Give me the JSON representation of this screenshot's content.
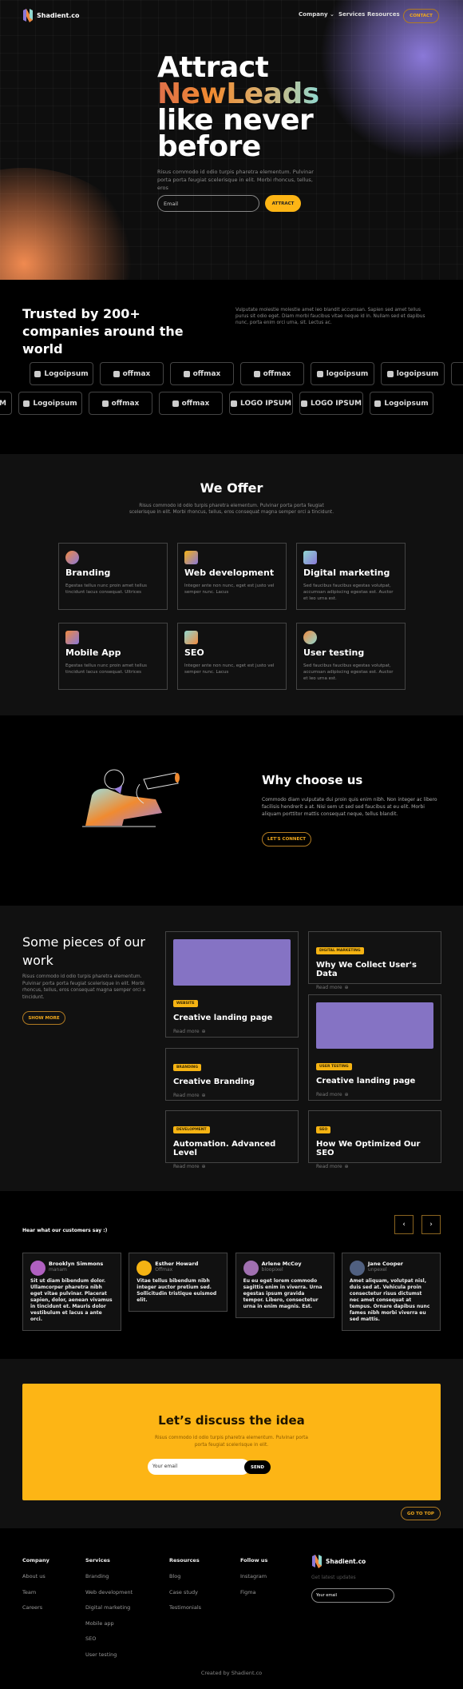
{
  "brand": {
    "name": "Shadient.co"
  },
  "nav": {
    "items": [
      "Company",
      "Services",
      "Resources"
    ],
    "contact": "CONTACT"
  },
  "hero": {
    "line1": "Attract",
    "line2": "NewLeads",
    "line3": "like never",
    "line4": "before",
    "text": "Risus commodo id odio turpis pharetra elementum. Pulvinar porta porta feugiat scelerisque in elit. Morbi rhoncus, tellus, eros",
    "email_placeholder": "Email",
    "cta": "ATTRACT"
  },
  "trusted": {
    "title": "Trusted by 200+ companies around the world",
    "text": "Vulputate molestie molestie amet leo blandit accumsan. Sapien sed amet tellus purus sit odio eget. Diam morbi faucibus vitae neque id in. Nullam sed et dapibus nunc, porta enim orci urna, sit. Lectus ac.",
    "row1": [
      "Logoipsum",
      "offmax",
      "offmax",
      "offmax",
      "logoipsum",
      "logoipsum"
    ],
    "row2": [
      "M",
      "Logoipsum",
      "offmax",
      "offmax",
      "LOGO IPSUM",
      "LOGO IPSUM",
      "Logoipsum"
    ]
  },
  "offer": {
    "title": "We Offer",
    "text": "Risus commodo id odio turpis pharetra elementum. Pulvinar porta porta feugiat scelerisque in elit. Morbi rhoncus, tellus, eros consequat magna semper orci a tincidunt.",
    "items": [
      {
        "title": "Branding",
        "text": "Egestas tellus nunc proin amet tellus tincidunt lacus consequat. Ultrices",
        "icon": "branding-icon"
      },
      {
        "title": "Web development",
        "text": "Integer ante non nunc, eget est justo vel semper nunc. Lacus",
        "icon": "web-icon"
      },
      {
        "title": "Digital marketing",
        "text": "Sed faucibus faucibus egestas volutpat, accumsan adipiscing egestas est. Auctor et leo urna est.",
        "icon": "marketing-icon"
      },
      {
        "title": "Mobile App",
        "text": "Egestas tellus nunc proin amet tellus tincidunt lacus consequat. Ultrices",
        "icon": "mobile-icon"
      },
      {
        "title": "SEO",
        "text": "Integer ante non nunc, eget est justo vel semper nunc. Lacus",
        "icon": "seo-icon"
      },
      {
        "title": "User testing",
        "text": "Sed faucibus faucibus egestas volutpat, accumsan adipiscing egestas est. Auctor et leo urna est.",
        "icon": "user-icon"
      }
    ]
  },
  "why": {
    "title": "Why choose us",
    "text": "Commodo diam vulputate dui proin quis enim nibh. Non integer ac libero facilisis hendrerit a at. Nisi sem ut sed sed faucibus at eu elit. Morbi aliquam porttitor mattis consequat neque, tellus blandit.",
    "cta": "LET'S CONNECT"
  },
  "work": {
    "title": "Some pieces of our work",
    "text": "Risus commodo id odio turpis pharetra elementum. Pulvinar porta porta feugiat scelerisque in elit. Morbi rhoncus, tellus, eros consequat magna semper orci a tincidunt.",
    "cta": "SHOW MORE",
    "read_more": "Read more",
    "items": [
      {
        "tag": "WEBSITE",
        "title": "Creative landing page"
      },
      {
        "tag": "DIGITAL MARKETING",
        "title": "Why We Collect User's Data"
      },
      {
        "tag": "USER TESTING",
        "title": "Creative landing page"
      },
      {
        "tag": "BRANDING",
        "title": "Creative Branding"
      },
      {
        "tag": "DEVELOPMENT",
        "title": "Automation. Advanced Level"
      },
      {
        "tag": "SEO",
        "title": "How We Optimized Our SEO"
      }
    ],
    "image_color": "#8573c4"
  },
  "testimonials": {
    "title": "Hear what our customers say :)",
    "prev": "‹",
    "next": "›",
    "items": [
      {
        "name": "Brooklyn Simmons",
        "company": "manam",
        "text": "Sit ut diam bibendum dolor. Ullamcorper pharetra nibh eget vitae pulvinar. Placerat sapien, dolor, aenean vivamus in tincidunt et. Mauris dolor vestibulum et lacus a ante orci."
      },
      {
        "name": "Esther Howard",
        "company": "Offmax",
        "text": "Vitae tellus bibendum nibh integer auctor pretium sed. Sollicitudin tristique euismod elit."
      },
      {
        "name": "Arlene McCoy",
        "company": "bloopixel",
        "text": "Eu eu eget lorem commodo sagittis enim in viverra. Urna egestas ipsum gravida tempor. Libero, consectetur urna in enim magnis. Est."
      },
      {
        "name": "Jane Cooper",
        "company": "unpexel",
        "text": "Amet aliquam, volutpat nisl, duis sed at. Vehicula proin consectetur risus dictumst nec amet consequat at tempus. Ornare dapibus nunc fames nibh morbi viverra eu sed mattis."
      }
    ]
  },
  "cta": {
    "title": "Let’s discuss the idea",
    "text": "Risus commodo id odio turpis pharetra elementum. Pulvinar porta porta feugiat scelerisque in elit.",
    "placeholder": "Your email",
    "send": "SEND",
    "top": "GO TO TOP",
    "color": "#fdb515"
  },
  "footer": {
    "cols": [
      {
        "title": "Company",
        "links": [
          "About us",
          "Team",
          "Careers"
        ]
      },
      {
        "title": "Services",
        "links": [
          "Branding",
          "Web development",
          "Digital marketing",
          "Mobile app",
          "SEO",
          "User testing"
        ]
      },
      {
        "title": "Resources",
        "links": [
          "Blog",
          "Case study",
          "Testimonials"
        ]
      },
      {
        "title": "Follow us",
        "links": [
          "Instagram",
          "Figma"
        ]
      }
    ],
    "updates": "Get latest updates",
    "placeholder": "Your email",
    "credit": "Created by Shadient.co"
  }
}
